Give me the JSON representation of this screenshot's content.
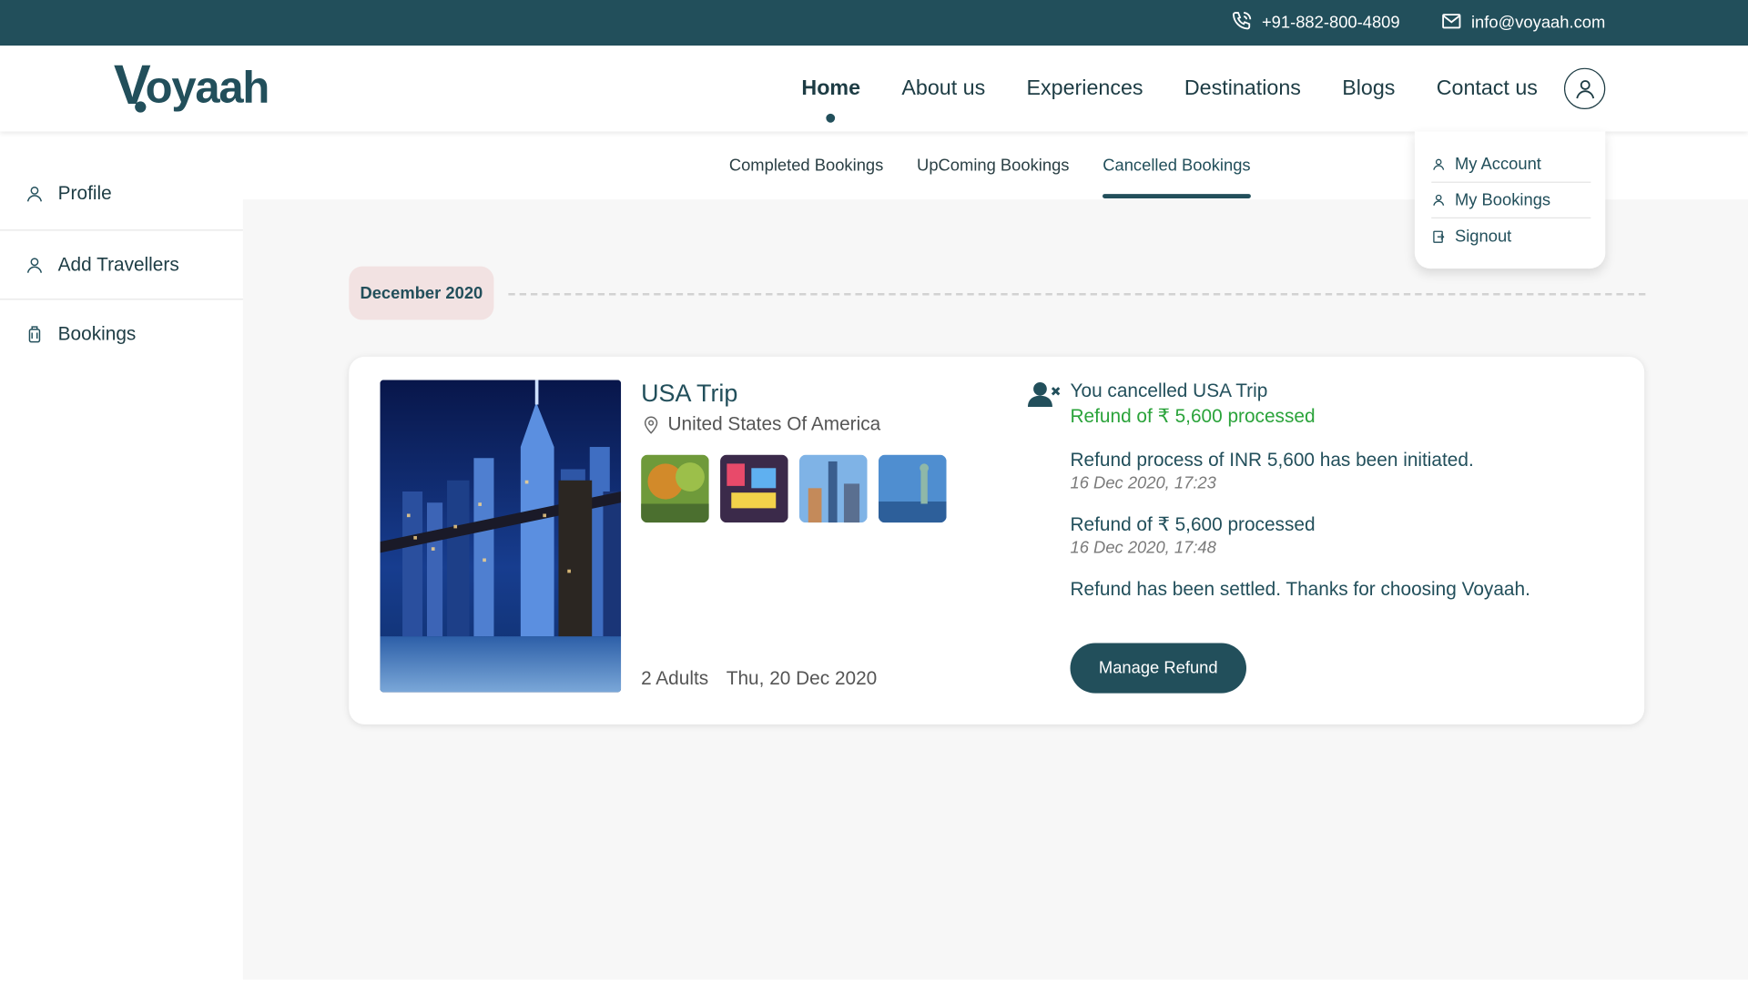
{
  "topbar": {
    "phone": "+91-882-800-4809",
    "email": "info@voyaah.com"
  },
  "brand": {
    "logo_first": "V",
    "logo_rest": "oyaah"
  },
  "nav": {
    "items": [
      "Home",
      "About us",
      "Experiences",
      "Destinations",
      "Blogs",
      "Contact us"
    ],
    "active": "Home"
  },
  "dropdown": {
    "items": [
      "My Account",
      "My Bookings",
      "Signout"
    ]
  },
  "sidebar": {
    "items": [
      "Profile",
      "Add Travellers",
      "Bookings"
    ]
  },
  "tabs": {
    "items": [
      "Completed Bookings",
      "UpComing Bookings",
      "Cancelled Bookings"
    ],
    "active": "Cancelled Bookings"
  },
  "month_label": "December 2020",
  "booking": {
    "title": "USA Trip",
    "location": "United States Of America",
    "adults": "2 Adults",
    "date": "Thu, 20 Dec 2020",
    "status_line": "You cancelled USA Trip",
    "status_refund": "Refund of ₹ 5,600 processed",
    "timeline": [
      {
        "text": "Refund process of INR 5,600 has been initiated.",
        "time": "16 Dec 2020, 17:23"
      },
      {
        "text": "Refund of ₹ 5,600 processed",
        "time": "16 Dec 2020, 17:48"
      }
    ],
    "settled": "Refund has been settled. Thanks for choosing Voyaah.",
    "button": "Manage Refund"
  },
  "colors": {
    "brand": "#224f5b",
    "refund_green": "#2aa33a",
    "month_bg": "#f2e2e2"
  }
}
